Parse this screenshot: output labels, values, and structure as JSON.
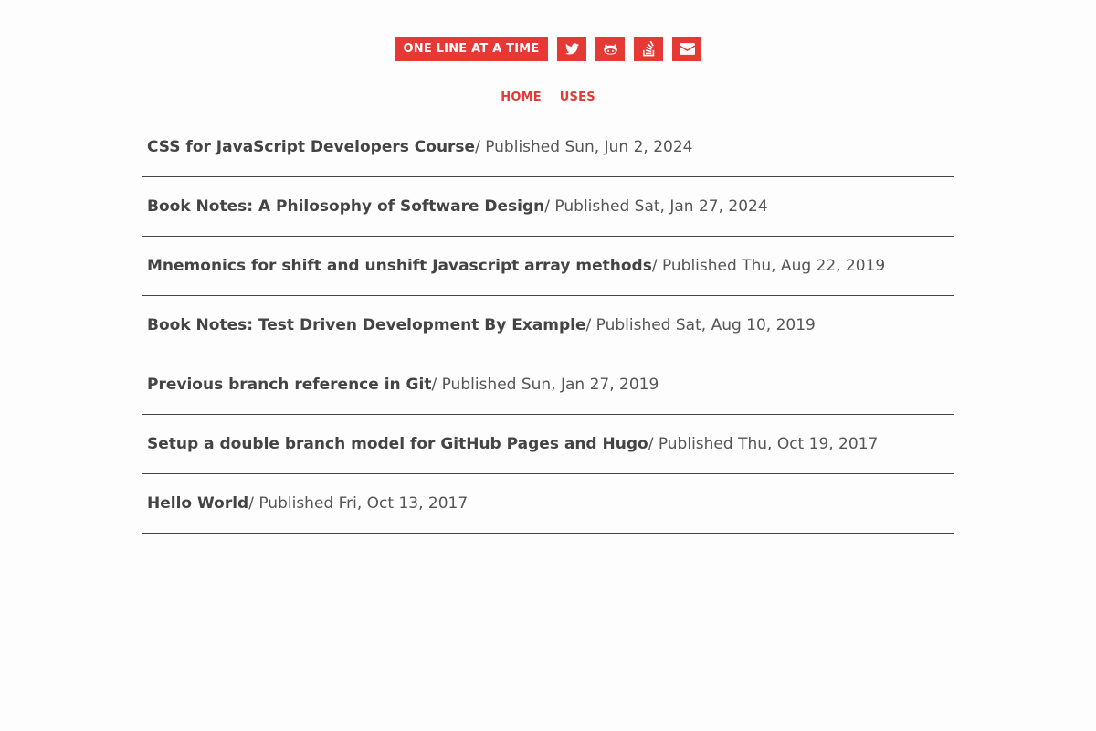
{
  "header": {
    "brand_label": "ONE LINE AT A TIME",
    "social_icons": [
      "twitter-icon",
      "github-icon",
      "stack-overflow-icon",
      "envelope-icon"
    ]
  },
  "nav": {
    "items": [
      {
        "label": "HOME"
      },
      {
        "label": "USES"
      }
    ]
  },
  "posts": [
    {
      "title": "CSS for JavaScript Developers Course",
      "meta": "/ Published Sun, Jun 2, 2024"
    },
    {
      "title": "Book Notes: A Philosophy of Software Design",
      "meta": "/ Published Sat, Jan 27, 2024"
    },
    {
      "title": "Mnemonics for shift and unshift Javascript array methods",
      "meta": "/ Published Thu, Aug 22, 2019"
    },
    {
      "title": "Book Notes: Test Driven Development By Example",
      "meta": "/ Published Sat, Aug 10, 2019"
    },
    {
      "title": "Previous branch reference in Git",
      "meta": "/ Published Sun, Jan 27, 2019"
    },
    {
      "title": "Setup a double branch model for GitHub Pages and Hugo",
      "meta": "/ Published Thu, Oct 19, 2017"
    },
    {
      "title": "Hello World",
      "meta": "/ Published Fri, Oct 13, 2017"
    }
  ],
  "colors": {
    "accent": "#e53935",
    "text": "#444444",
    "background": "#fdfdfd"
  }
}
